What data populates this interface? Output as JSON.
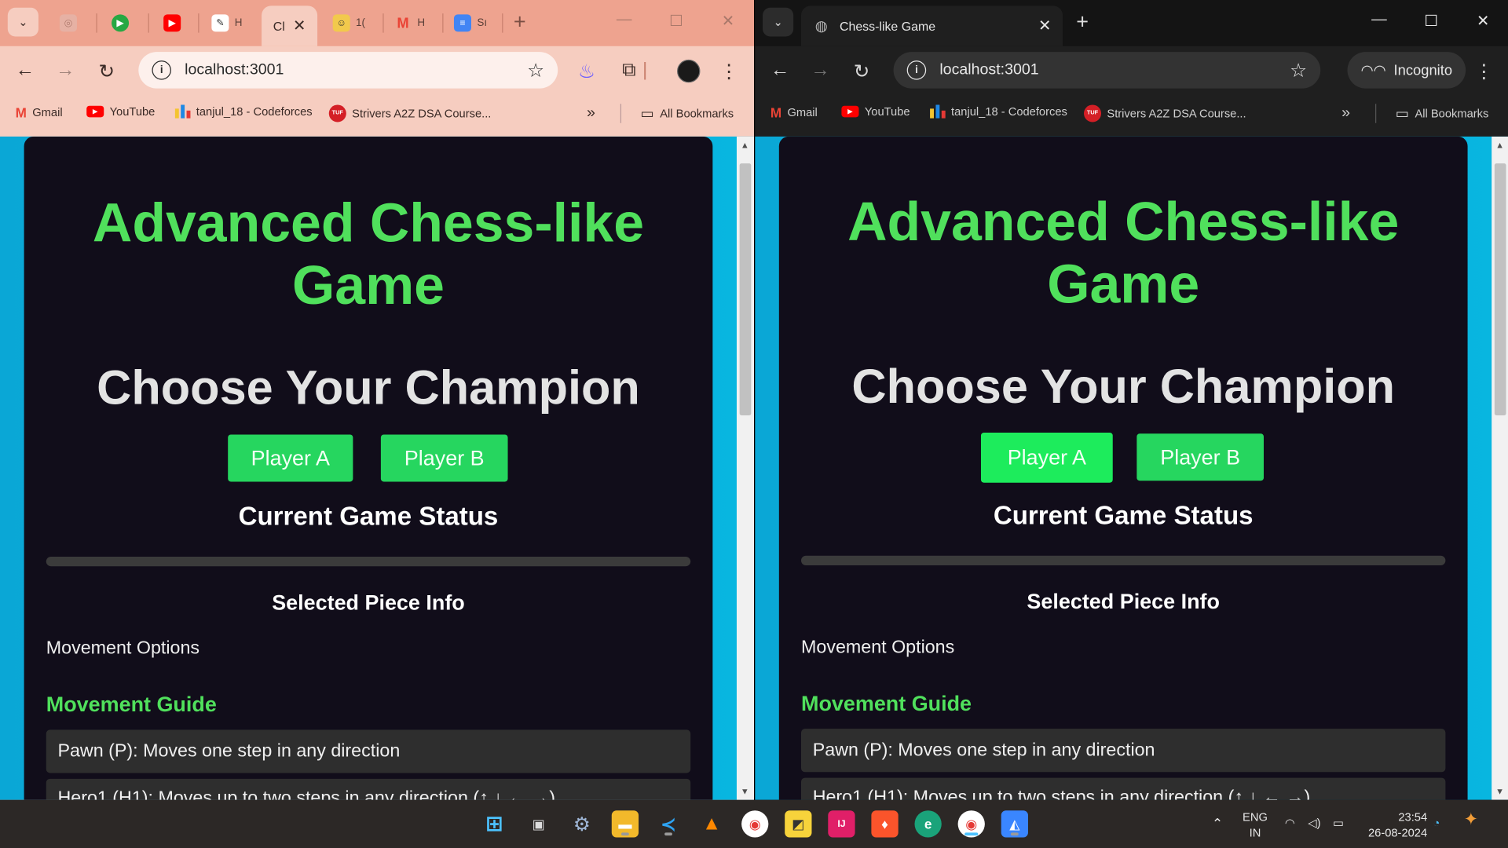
{
  "browser_left": {
    "tabs": [
      {
        "label": "H"
      },
      {
        "label": "Cl"
      },
      {
        "label": "1("
      },
      {
        "label": "H"
      },
      {
        "label": "Sı"
      }
    ],
    "omnibox": {
      "url": "localhost:3001"
    },
    "bookmarks": [
      "Gmail",
      "YouTube",
      "tanjul_18 - Codeforces",
      "Strivers A2Z DSA Course...",
      "All Bookmarks"
    ]
  },
  "browser_right": {
    "active_tab": "Chess-like Game",
    "omnibox": {
      "url": "localhost:3001"
    },
    "incognito_label": "Incognito",
    "bookmarks": [
      "Gmail",
      "YouTube",
      "tanjul_18 - Codeforces",
      "Strivers A2Z DSA Course...",
      "All Bookmarks"
    ]
  },
  "page": {
    "title": "Advanced Chess-like Game",
    "heading": "Choose Your Champion",
    "player_a": "Player A",
    "player_b": "Player B",
    "status_heading": "Current Game Status",
    "selected_heading": "Selected Piece Info",
    "movement_options": "Movement Options",
    "guide_heading": "Movement Guide",
    "guide_items": [
      "Pawn (P): Moves one step in any direction",
      "Hero1 (H1): Moves up to two steps in any direction (↑ ↓ ← →)"
    ]
  },
  "taskbar": {
    "lang": "ENG",
    "region": "IN",
    "time": "23:54",
    "date": "26-08-2024"
  },
  "colors": {
    "accent_green": "#50e05c",
    "button_green": "#26d65f",
    "page_bg": "#110d1a",
    "outer_bg": "#08b6e0"
  }
}
